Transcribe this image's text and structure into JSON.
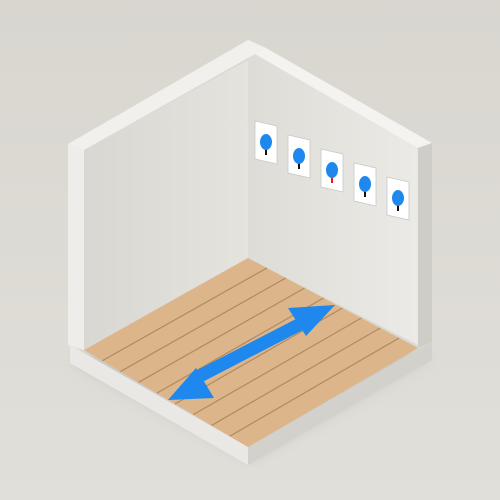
{
  "palette": {
    "background": "#dcdad4",
    "left_wall_face": "#dddbd5",
    "left_wall_edge": "#f1f0ec",
    "left_wall_side": "#c9c7c1",
    "back_wall_face": "#e6e5e0",
    "back_wall_top": "#f4f3f0",
    "back_wall_side": "#d2d0ca",
    "base_front_left": "#e9e8e4",
    "base_front_right": "#d6d4ce",
    "floor": "#dcb58a",
    "floor_line": "#b08a60",
    "arrow": "#1e88ee",
    "card_bg": "#ffffff",
    "card_border": "#c8c8c8",
    "tree_canopy": "#1e88ee",
    "tree_trunk": "#111111",
    "accent_red": "#e02020"
  },
  "icons": {
    "arrow": "double-headed-arrow-icon",
    "tree": "tree-icon"
  },
  "wall_cards": [
    {
      "name": "wall-card-1",
      "trunk_color": "tree_trunk"
    },
    {
      "name": "wall-card-2",
      "trunk_color": "tree_trunk"
    },
    {
      "name": "wall-card-3",
      "trunk_color": "accent_red"
    },
    {
      "name": "wall-card-4",
      "trunk_color": "tree_trunk"
    },
    {
      "name": "wall-card-5",
      "trunk_color": "tree_trunk"
    }
  ]
}
